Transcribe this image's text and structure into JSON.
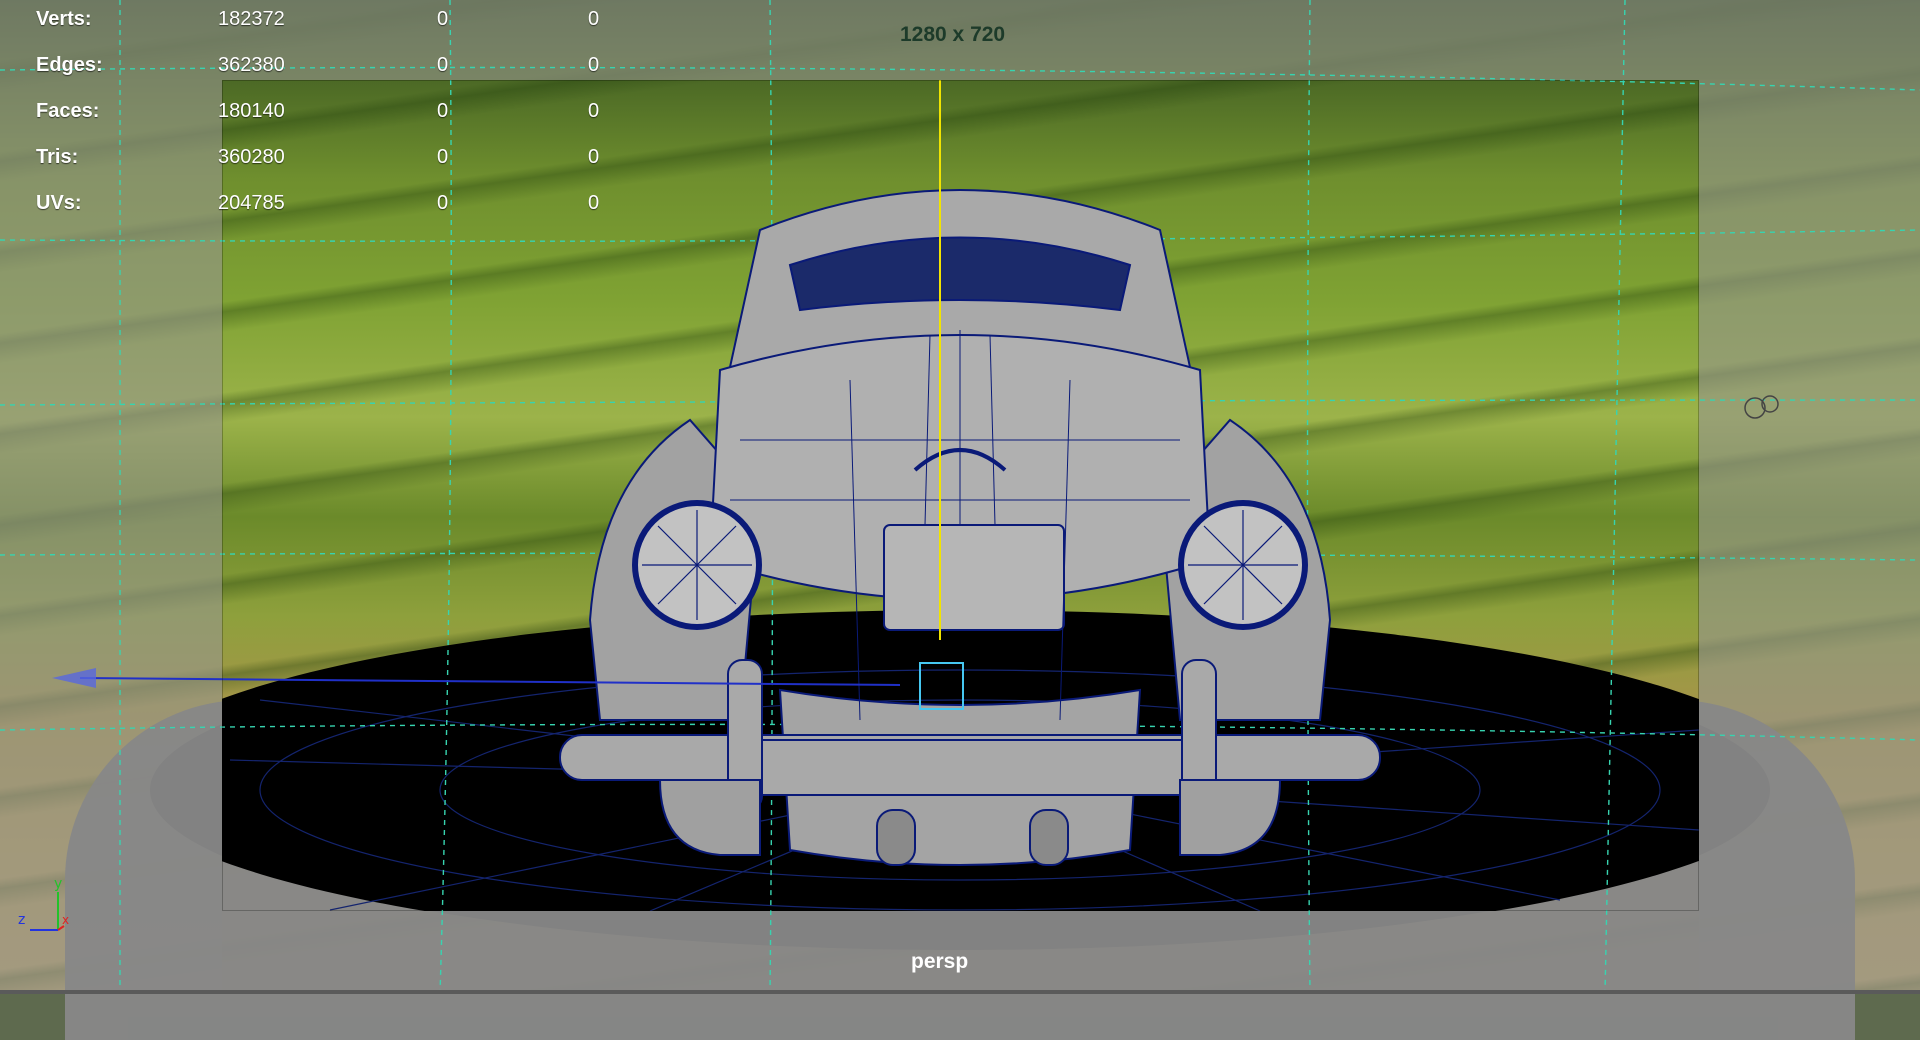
{
  "viewport": {
    "camera_label": "persp",
    "resolution_gate_label": "1280 x 720"
  },
  "hud": {
    "rows": [
      {
        "label": "Verts:",
        "total": "182372",
        "selected": "0",
        "component": "0"
      },
      {
        "label": "Edges:",
        "total": "362380",
        "selected": "0",
        "component": "0"
      },
      {
        "label": "Faces:",
        "total": "180140",
        "selected": "0",
        "component": "0"
      },
      {
        "label": "Tris:",
        "total": "360280",
        "selected": "0",
        "component": "0"
      },
      {
        "label": "UVs:",
        "total": "204785",
        "selected": "0",
        "component": "0"
      }
    ]
  },
  "axis_indicator": {
    "labels": [
      "z",
      "x",
      "y"
    ]
  },
  "colors": {
    "wireframe": "#0a1a78",
    "grid": "#37d4b0",
    "pivot_line": "#f1e400",
    "selection_box": "#46c7f1",
    "car_body": "#a9a9a9"
  },
  "icons": {
    "axis": "view-axis-icon",
    "manipulator": "move-manipulator-icon"
  }
}
